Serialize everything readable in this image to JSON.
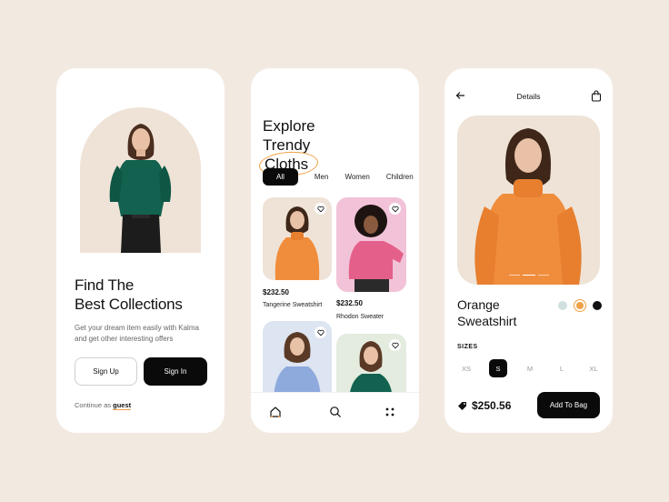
{
  "screen1": {
    "title_line1": "Find The",
    "title_line2": "Best Collections",
    "description": "Get your dream item easily with Kalma and get other interesting offers",
    "signup_label": "Sign Up",
    "signin_label": "Sign In",
    "continue_prefix": "Continue as",
    "guest_label": "guest"
  },
  "screen2": {
    "title_line1": "Explore",
    "title_word": "Trendy",
    "title_circled": "Cloths",
    "filters": [
      "All",
      "Men",
      "Women",
      "Children"
    ],
    "active_filter": "All",
    "products": [
      {
        "price": "$232.50",
        "name": "Tangerine Sweatshirt"
      },
      {
        "price": "$232.50",
        "name": "Rhodon Sweater"
      },
      {
        "price": "",
        "name": ""
      },
      {
        "price": "",
        "name": ""
      }
    ],
    "nav_icons": [
      "home-icon",
      "search-icon",
      "grid-icon"
    ]
  },
  "screen3": {
    "header_title": "Details",
    "product_name_line1": "Orange",
    "product_name_line2": "Sweatshirt",
    "colors": [
      "#cfe0de",
      "#f0a045",
      "#111111"
    ],
    "selected_color": "#f0a045",
    "sizes_label": "SIZES",
    "sizes": [
      "XS",
      "S",
      "M",
      "L",
      "XL"
    ],
    "selected_size": "S",
    "price": "$250.56",
    "add_to_bag_label": "Add To Bag"
  },
  "colors": {
    "background": "#f2e9e1",
    "accent": "#f0a045",
    "dark": "#0a0a0a",
    "orange_sweater": "#f08d3c",
    "green_sweater": "#12624f",
    "pink_sweater": "#e4608a",
    "blue_sweater": "#8ea9dc"
  }
}
